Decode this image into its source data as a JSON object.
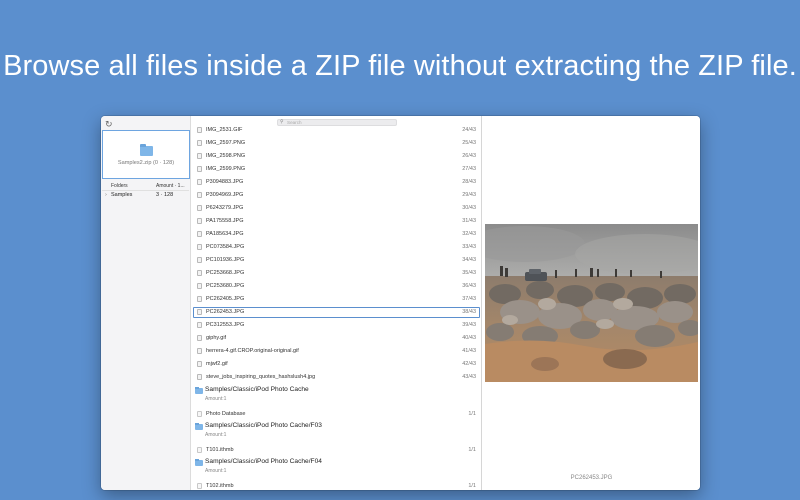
{
  "headline": "Browse all files inside a ZIP file without extracting the ZIP file.",
  "sidebar": {
    "zip_label": "Samples2.zip (0 · 128)",
    "col_folders": "Folders",
    "col_amount": "Amount · 1...",
    "tree": [
      {
        "disclosure": "›",
        "name": "Samples",
        "amount": "3 · 128"
      }
    ]
  },
  "search": {
    "placeholder": "Search"
  },
  "files": [
    {
      "name": "IMG_2531.GIF",
      "count": "24/43"
    },
    {
      "name": "IMG_2597.PNG",
      "count": "25/43"
    },
    {
      "name": "IMG_2598.PNG",
      "count": "26/43"
    },
    {
      "name": "IMG_2599.PNG",
      "count": "27/43"
    },
    {
      "name": "P3094883.JPG",
      "count": "28/43"
    },
    {
      "name": "P3094969.JPG",
      "count": "29/43"
    },
    {
      "name": "P6243279.JPG",
      "count": "30/43"
    },
    {
      "name": "PA175558.JPG",
      "count": "31/43"
    },
    {
      "name": "PA185634.JPG",
      "count": "32/43"
    },
    {
      "name": "PC073584.JPG",
      "count": "33/43"
    },
    {
      "name": "PC101936.JPG",
      "count": "34/43"
    },
    {
      "name": "PC253668.JPG",
      "count": "35/43"
    },
    {
      "name": "PC253680.JPG",
      "count": "36/43"
    },
    {
      "name": "PC262405.JPG",
      "count": "37/43"
    },
    {
      "name": "PC262453.JPG",
      "count": "38/43"
    },
    {
      "name": "PC312553.JPG",
      "count": "39/43"
    },
    {
      "name": "giphy.gif",
      "count": "40/43"
    },
    {
      "name": "herrera-4.gif.CROP.original-original.gif",
      "count": "41/43"
    },
    {
      "name": "mjwf2.gif",
      "count": "42/43"
    },
    {
      "name": "steve_jobs_inspiring_quotes_hashslush4.jpg",
      "count": "43/43"
    }
  ],
  "groups": [
    {
      "name": "Samples/Classic/iPod Photo Cache",
      "amount": "Amount:1",
      "file": "Photo Database",
      "count": "1/1"
    },
    {
      "name": "Samples/Classic/iPod Photo Cache/F03",
      "amount": "Amount:1",
      "file": "T101.ithmb",
      "count": "1/1"
    },
    {
      "name": "Samples/Classic/iPod Photo Cache/F04",
      "amount": "Amount:1",
      "file": "T102.ithmb",
      "count": "1/1"
    }
  ],
  "preview": {
    "caption": "PC262453.JPG"
  },
  "icons": {
    "refresh": "refresh-icon",
    "search": "magnifier-icon",
    "folder": "folder-icon",
    "file": "document-icon"
  },
  "colors": {
    "background": "#5b8fce",
    "selection": "#5b8fce",
    "folder": "#7fb6e8"
  }
}
